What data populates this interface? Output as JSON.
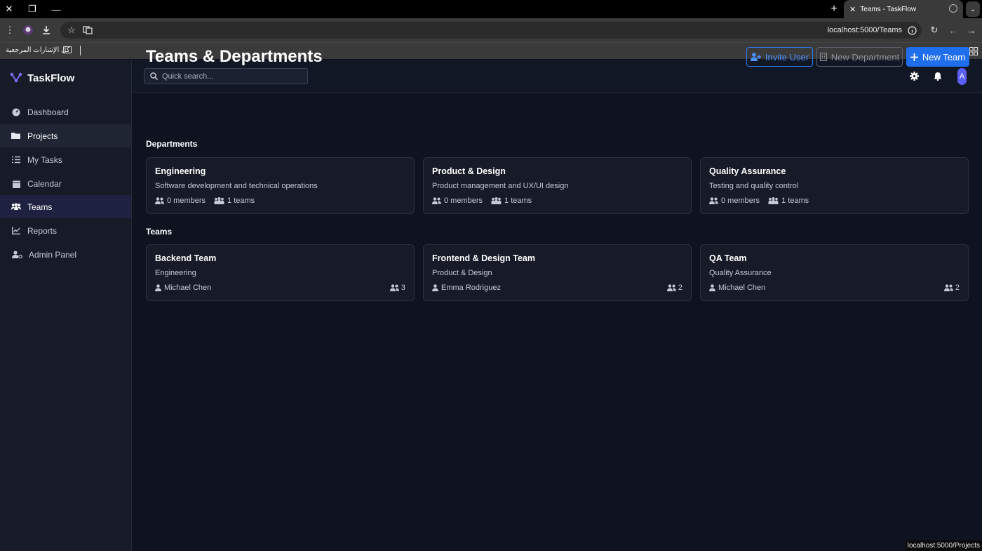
{
  "browser": {
    "tab_title": "Teams - TaskFlow",
    "url": "localhost:5000/Teams",
    "bookmarks_label": "كل الإشارات المرجعية",
    "status_url": "localhost:5000/Projects"
  },
  "app": {
    "brand": "TaskFlow",
    "accent_color": "#1f6fec"
  },
  "sidebar": {
    "items": [
      {
        "label": "Dashboard",
        "icon": "dashboard-icon"
      },
      {
        "label": "Projects",
        "icon": "folder-icon"
      },
      {
        "label": "My Tasks",
        "icon": "tasks-icon"
      },
      {
        "label": "Calendar",
        "icon": "calendar-icon"
      },
      {
        "label": "Teams",
        "icon": "users-icon"
      },
      {
        "label": "Reports",
        "icon": "chart-icon"
      },
      {
        "label": "Admin Panel",
        "icon": "user-gear-icon"
      }
    ],
    "active": "Teams"
  },
  "topbar": {
    "search_placeholder": "Quick search...",
    "avatar_initial": "A"
  },
  "page": {
    "title": "Teams & Departments",
    "buttons": {
      "invite": "Invite User",
      "new_department": "New Department",
      "new_team": "New Team"
    },
    "departments_label": "Departments",
    "teams_label": "Teams"
  },
  "departments": [
    {
      "name": "Engineering",
      "description": "Software development and technical operations",
      "members": "0 members",
      "teams": "1 teams"
    },
    {
      "name": "Product & Design",
      "description": "Product management and UX/UI design",
      "members": "0 members",
      "teams": "1 teams"
    },
    {
      "name": "Quality Assurance",
      "description": "Testing and quality control",
      "members": "0 members",
      "teams": "1 teams"
    }
  ],
  "teams": [
    {
      "name": "Backend Team",
      "department": "Engineering",
      "lead": "Michael Chen",
      "count": "3"
    },
    {
      "name": "Frontend & Design Team",
      "department": "Product & Design",
      "lead": "Emma Rodriguez",
      "count": "2"
    },
    {
      "name": "QA Team",
      "department": "Quality Assurance",
      "lead": "Michael Chen",
      "count": "2"
    }
  ]
}
